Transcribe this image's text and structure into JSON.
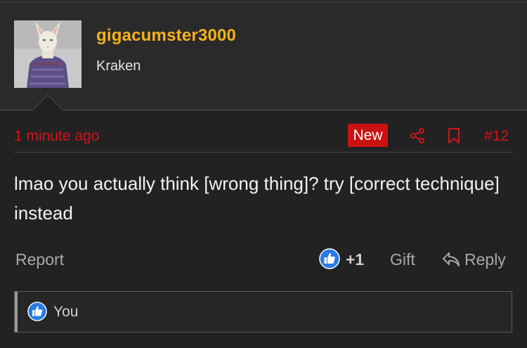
{
  "user": {
    "name": "gigacumster3000",
    "title": "Kraken"
  },
  "post": {
    "timestamp": "1 minute ago",
    "badge": "New",
    "number": "#12",
    "body": "lmao you actually think [wrong thing]? try [correct technique] instead"
  },
  "actions": {
    "report": "Report",
    "like_count": "+1",
    "gift": "Gift",
    "reply": "Reply"
  },
  "reactions": {
    "label": "You"
  },
  "colors": {
    "username": "#f6b21b",
    "accent_red": "#d2141c",
    "like_blue": "#2a7be4"
  },
  "icons": {
    "share": "share-icon",
    "bookmark": "bookmark-icon",
    "like": "thumbs-up-icon",
    "reply": "reply-arrow-icon"
  }
}
